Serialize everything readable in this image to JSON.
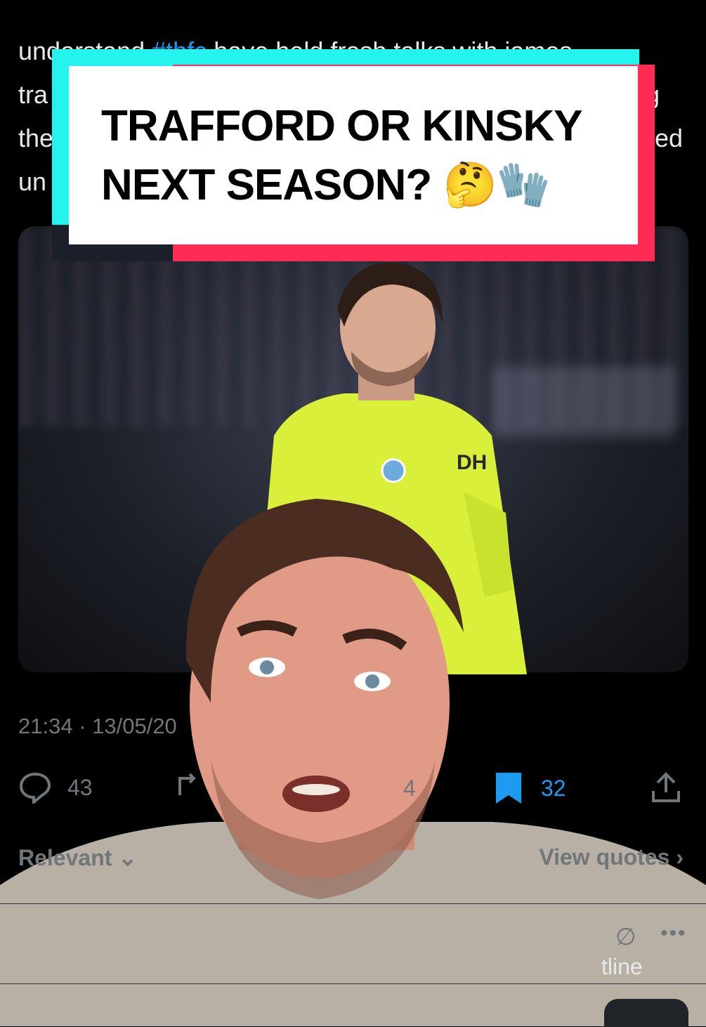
{
  "tweet": {
    "text_prefix": "understand ",
    "hashtag": "#thfc",
    "text_line1_rest": " have held fresh talks with james",
    "text_line2": "tra",
    "text_line2_end": "g",
    "text_line3": "the",
    "text_line3_end": "ed",
    "text_line4": "un",
    "timestamp": "21:34 · 13/05/20"
  },
  "overlay": {
    "line1": "TRAFFORD OR KINSKY",
    "line2": "NEXT SEASON? 🤔🧤"
  },
  "actions": {
    "replies": "43",
    "likes_partial": "4",
    "bookmarks": "32"
  },
  "sort": {
    "label": "Relevant",
    "quotes_label": "View quotes"
  },
  "reply_preview": {
    "text": "tline"
  },
  "colors": {
    "accent": "#1d9bf0",
    "tiktok_cyan": "#25f4ee",
    "tiktok_red": "#fe2c55",
    "kit_yellow": "#d9ef3a"
  }
}
